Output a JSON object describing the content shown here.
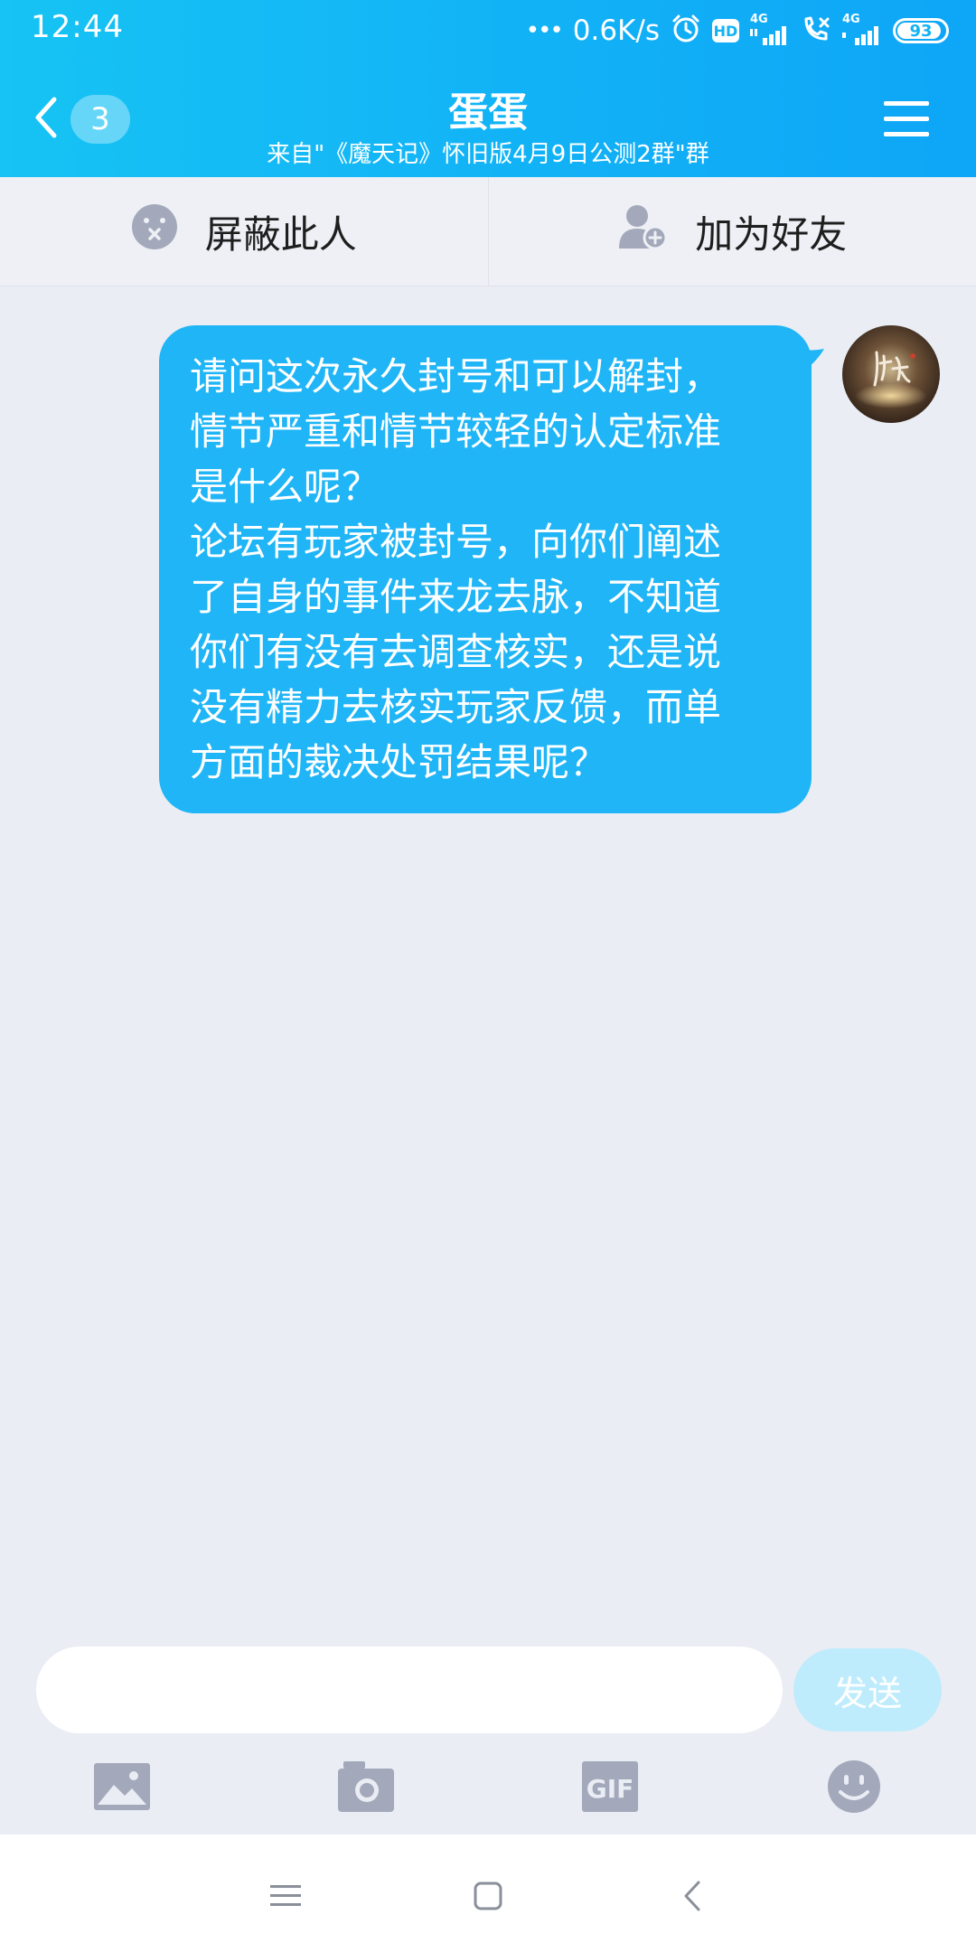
{
  "status_bar": {
    "time": "12:44",
    "net_dots": "•••",
    "net_speed": "0.6K/s",
    "hd_label": "HD",
    "network_label": "4G",
    "network_label_2": "4G",
    "battery_level": "93",
    "battery_fraction": 0.93
  },
  "header": {
    "title": "蛋蛋",
    "subtitle": "来自\"《魔天记》怀旧版4月9日公测2群\"群",
    "unread_count": "3"
  },
  "actions": {
    "block_label": "屏蔽此人",
    "add_friend_label": "加为好友"
  },
  "message": {
    "lines": [
      "请问这次永久封号和可以解封，",
      "情节严重和情节较轻的认定标准",
      "是什么呢？",
      "论坛有玩家被封号，向你们阐述",
      "了自身的事件来龙去脉，不知道",
      "你们有没有去调查核实，还是说",
      "没有精力去核实玩家反馈，而单",
      "方面的裁决处罚结果呢？"
    ]
  },
  "composer": {
    "input_value": "",
    "send_label": "发送",
    "gif_label": "GIF"
  },
  "colors": {
    "header_gradient_start": "#16c3f4",
    "header_gradient_end": "#0ea6f7",
    "bubble": "#1fb5f6",
    "send_button": "#bfecfc",
    "page_background": "#eaedf4",
    "icon_gray": "#a3a9bb"
  },
  "icons": {
    "back": "chevron-left-icon",
    "menu": "menu-icon",
    "block": "block-face-icon",
    "add_friend": "add-friend-icon",
    "image": "image-icon",
    "camera": "camera-icon",
    "gif": "gif-icon",
    "emoji": "emoji-icon"
  }
}
